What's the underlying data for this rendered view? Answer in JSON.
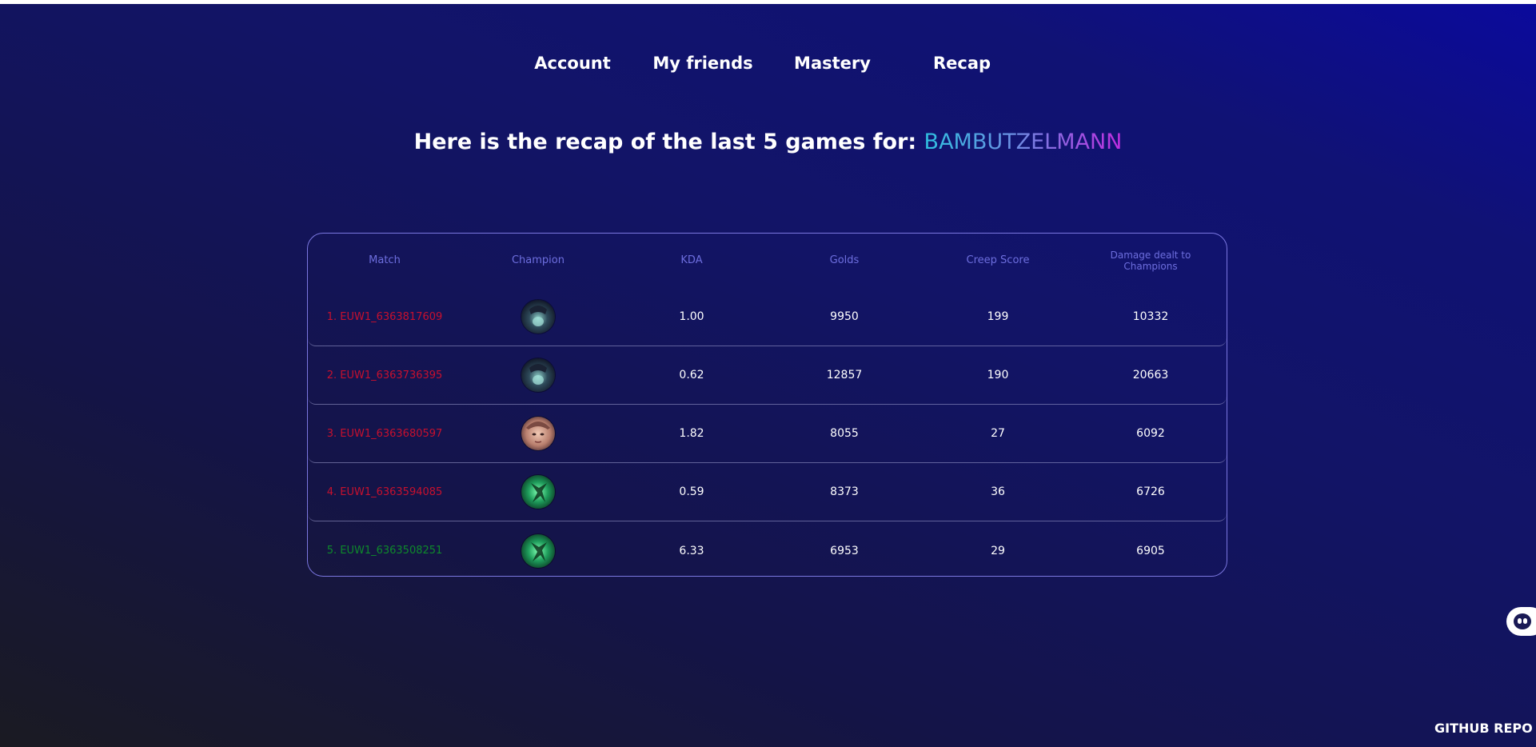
{
  "nav": {
    "items": [
      {
        "label": "Account"
      },
      {
        "label": "My friends"
      },
      {
        "label": "Mastery"
      },
      {
        "label": "Recap"
      }
    ]
  },
  "heading": {
    "prefix": "Here is the recap of the last 5 games for: ",
    "player": "BAMBUTZELMANN"
  },
  "table": {
    "columns": [
      "Match",
      "Champion",
      "KDA",
      "Golds",
      "Creep Score",
      "Damage dealt to Champions"
    ],
    "rows": [
      {
        "match": "1. EUW1_6363817609",
        "result": "loss",
        "champion_icon": "champion-portrait-dark-blue",
        "kda": "1.00",
        "golds": "9950",
        "cs": "199",
        "damage": "10332"
      },
      {
        "match": "2. EUW1_6363736395",
        "result": "loss",
        "champion_icon": "champion-portrait-dark-blue",
        "kda": "0.62",
        "golds": "12857",
        "cs": "190",
        "damage": "20663"
      },
      {
        "match": "3. EUW1_6363680597",
        "result": "loss",
        "champion_icon": "champion-portrait-face",
        "kda": "1.82",
        "golds": "8055",
        "cs": "27",
        "damage": "6092"
      },
      {
        "match": "4. EUW1_6363594085",
        "result": "loss",
        "champion_icon": "champion-portrait-green",
        "kda": "0.59",
        "golds": "8373",
        "cs": "36",
        "damage": "6726"
      },
      {
        "match": "5. EUW1_6363508251",
        "result": "win",
        "champion_icon": "champion-portrait-green",
        "kda": "6.33",
        "golds": "6953",
        "cs": "29",
        "damage": "6905"
      }
    ]
  },
  "colors": {
    "loss": "#c8102e",
    "win": "#0e8a2b",
    "header_text": "#6d6ede",
    "card_border": "#7b77e0"
  },
  "footer": {
    "github_label": "GITHUB REPO"
  },
  "widget": {
    "icon": "assistant-face-icon"
  }
}
